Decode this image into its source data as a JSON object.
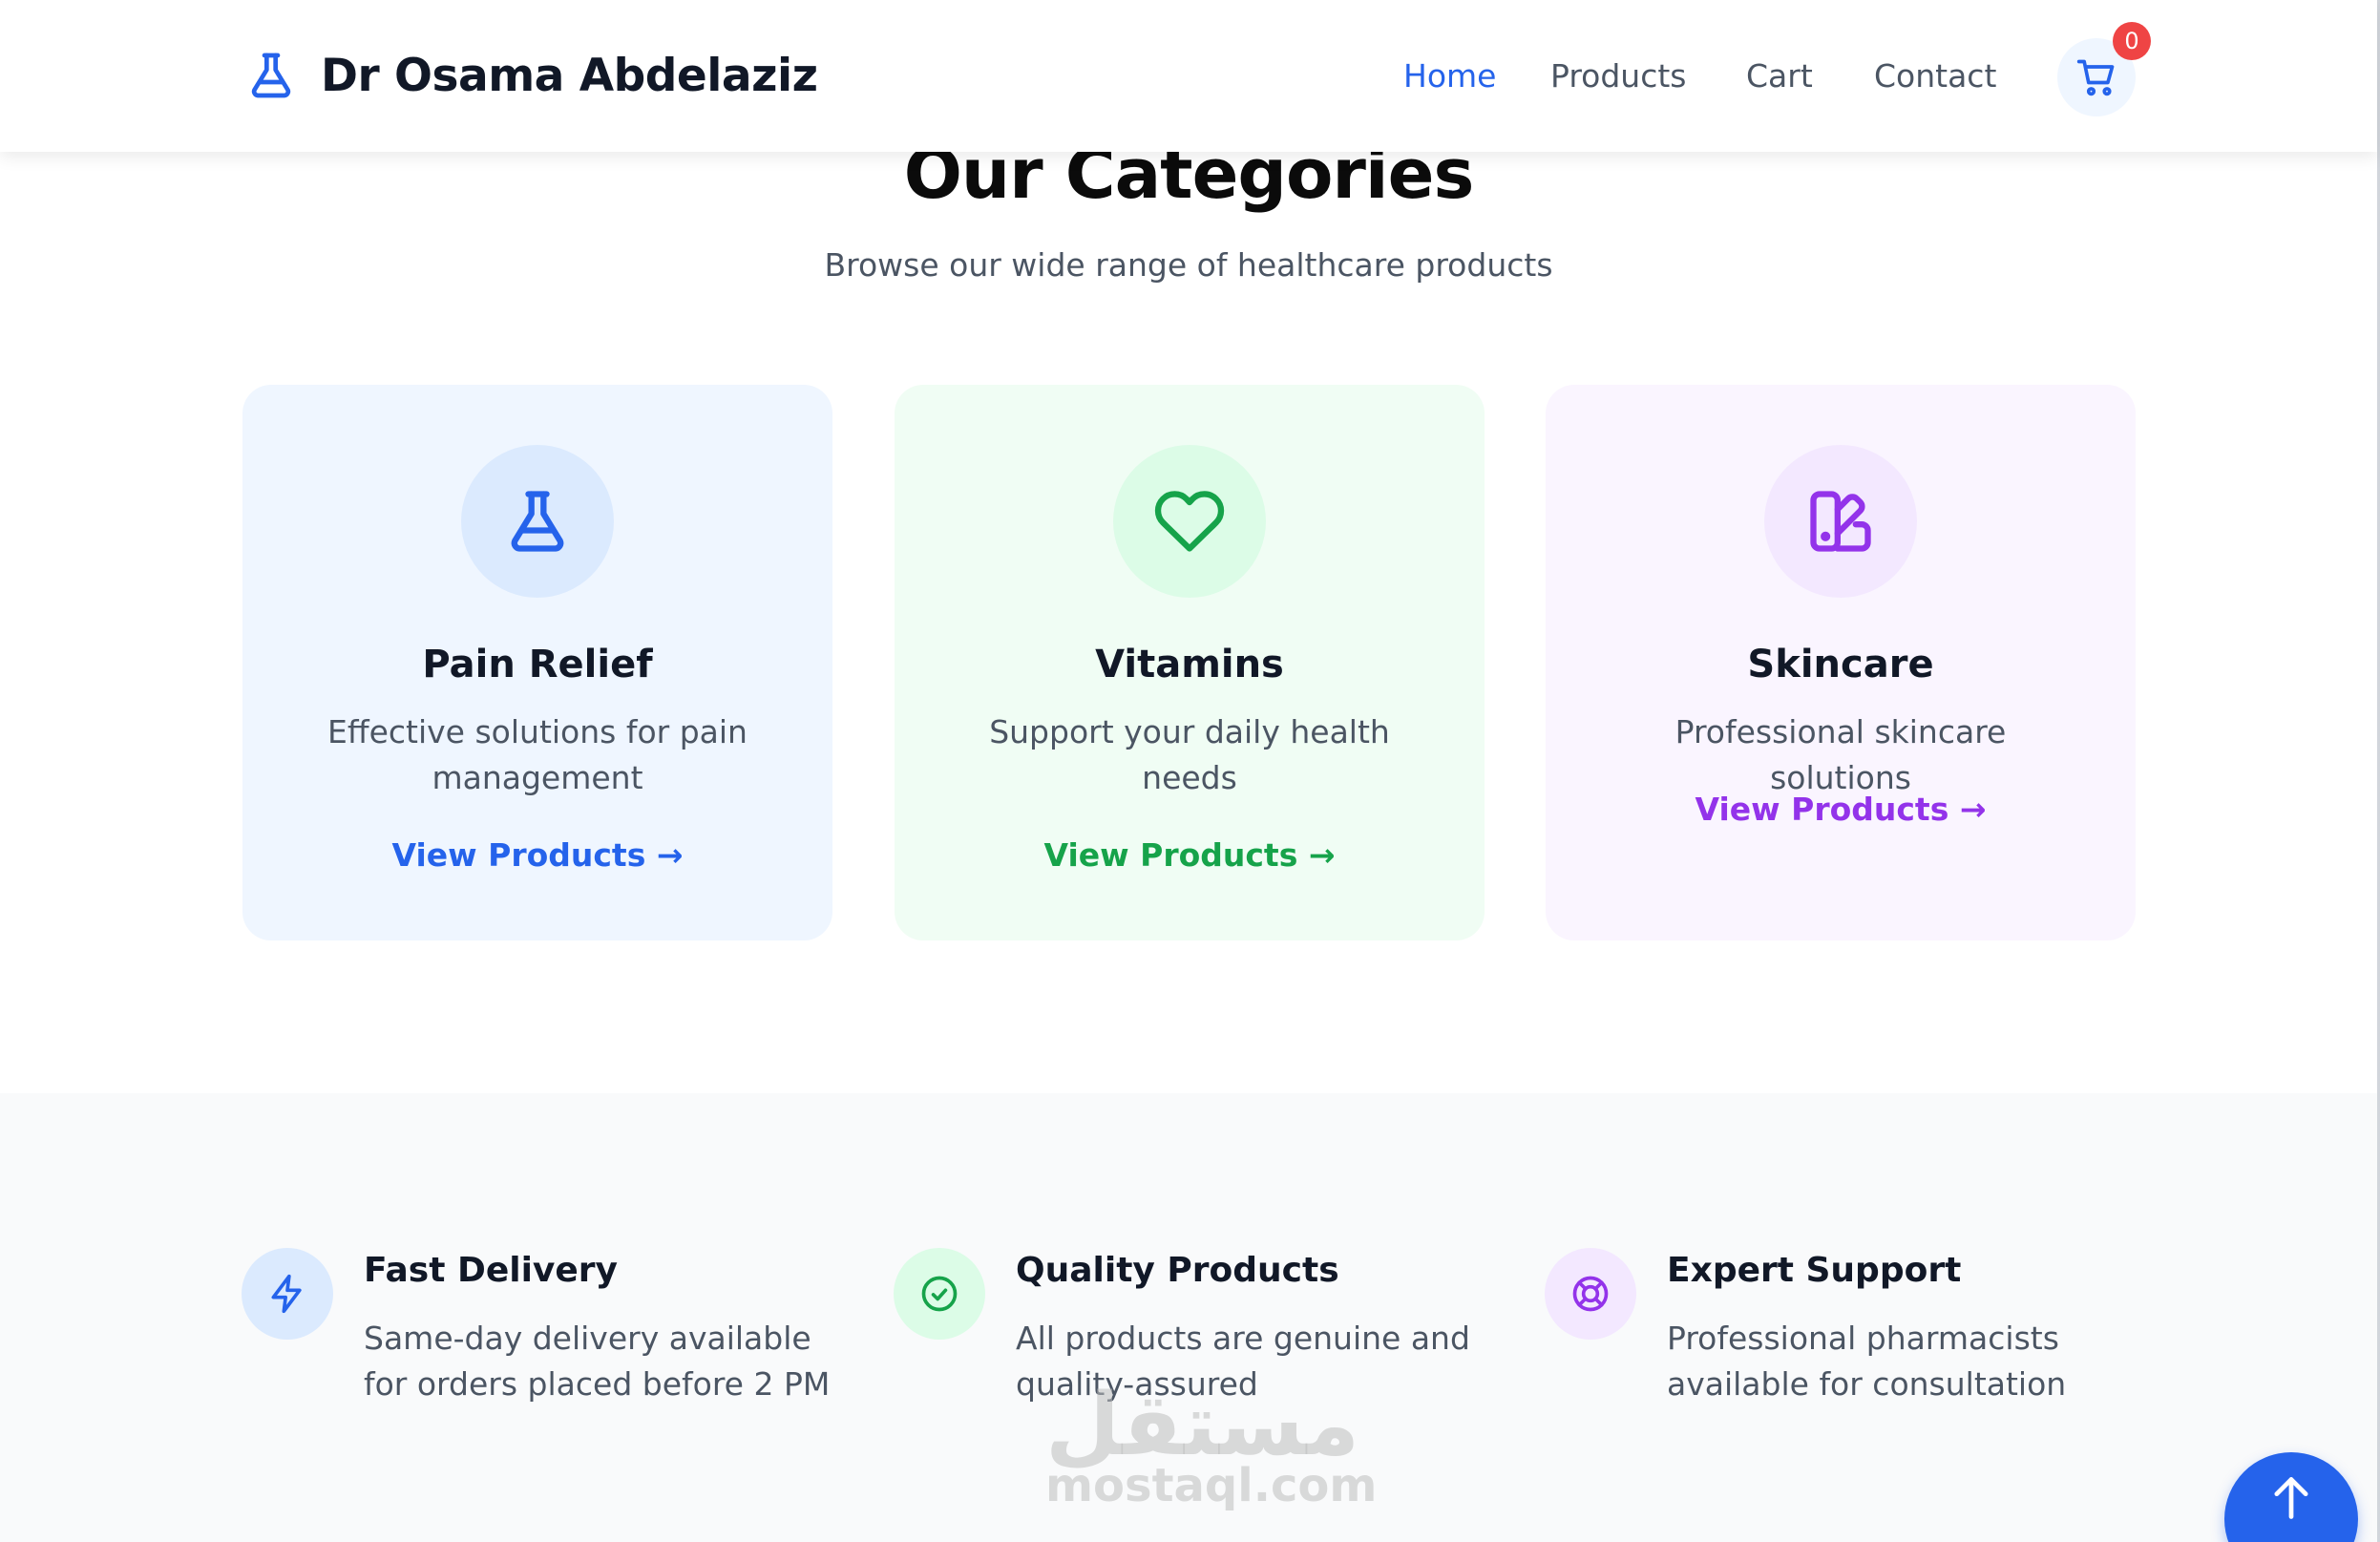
{
  "header": {
    "brand_name": "Dr Osama Abdelaziz",
    "brand_icon": "flask-icon",
    "nav": [
      {
        "label": "Home",
        "active": true
      },
      {
        "label": "Products",
        "active": false
      },
      {
        "label": "Cart",
        "active": false
      },
      {
        "label": "Contact",
        "active": false
      }
    ],
    "cart_icon": "cart-icon",
    "cart_count": "0"
  },
  "categories": {
    "title": "Our Categories",
    "subtitle": "Browse our wide range of healthcare products",
    "items": [
      {
        "title": "Pain Relief",
        "description": "Effective solutions for pain management",
        "link": "View Products →",
        "icon": "flask-icon",
        "accent": "#2563eb"
      },
      {
        "title": "Vitamins",
        "description": "Support your daily health needs",
        "link": "View Products →",
        "icon": "heart-icon",
        "accent": "#16a34a"
      },
      {
        "title": "Skincare",
        "description": "Professional skincare solutions",
        "link": "View Products →",
        "icon": "swatch-icon",
        "accent": "#9333ea"
      }
    ]
  },
  "features": [
    {
      "title": "Fast Delivery",
      "description": "Same-day delivery available for orders placed before 2 PM",
      "icon": "bolt-icon",
      "accent": "#2563eb"
    },
    {
      "title": "Quality Products",
      "description": "All products are genuine and quality-assured",
      "icon": "check-circle-icon",
      "accent": "#16a34a"
    },
    {
      "title": "Expert Support",
      "description": "Professional pharmacists available for consultation",
      "icon": "lifebuoy-icon",
      "accent": "#9333ea"
    }
  ],
  "watermark": {
    "arabic": "مستقل",
    "latin": "mostaql.com"
  },
  "scroll_top_icon": "arrow-up-icon"
}
